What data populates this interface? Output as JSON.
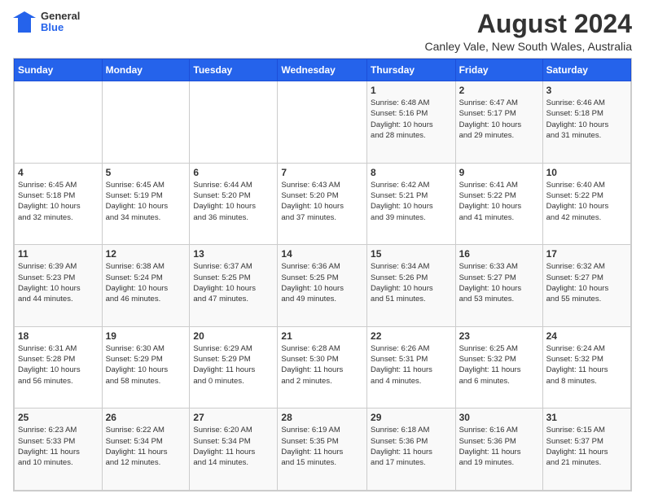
{
  "header": {
    "logo_general": "General",
    "logo_blue": "Blue",
    "main_title": "August 2024",
    "subtitle": "Canley Vale, New South Wales, Australia"
  },
  "calendar": {
    "headers": [
      "Sunday",
      "Monday",
      "Tuesday",
      "Wednesday",
      "Thursday",
      "Friday",
      "Saturday"
    ],
    "weeks": [
      [
        {
          "day": "",
          "info": ""
        },
        {
          "day": "",
          "info": ""
        },
        {
          "day": "",
          "info": ""
        },
        {
          "day": "",
          "info": ""
        },
        {
          "day": "1",
          "info": "Sunrise: 6:48 AM\nSunset: 5:16 PM\nDaylight: 10 hours\nand 28 minutes."
        },
        {
          "day": "2",
          "info": "Sunrise: 6:47 AM\nSunset: 5:17 PM\nDaylight: 10 hours\nand 29 minutes."
        },
        {
          "day": "3",
          "info": "Sunrise: 6:46 AM\nSunset: 5:18 PM\nDaylight: 10 hours\nand 31 minutes."
        }
      ],
      [
        {
          "day": "4",
          "info": "Sunrise: 6:45 AM\nSunset: 5:18 PM\nDaylight: 10 hours\nand 32 minutes."
        },
        {
          "day": "5",
          "info": "Sunrise: 6:45 AM\nSunset: 5:19 PM\nDaylight: 10 hours\nand 34 minutes."
        },
        {
          "day": "6",
          "info": "Sunrise: 6:44 AM\nSunset: 5:20 PM\nDaylight: 10 hours\nand 36 minutes."
        },
        {
          "day": "7",
          "info": "Sunrise: 6:43 AM\nSunset: 5:20 PM\nDaylight: 10 hours\nand 37 minutes."
        },
        {
          "day": "8",
          "info": "Sunrise: 6:42 AM\nSunset: 5:21 PM\nDaylight: 10 hours\nand 39 minutes."
        },
        {
          "day": "9",
          "info": "Sunrise: 6:41 AM\nSunset: 5:22 PM\nDaylight: 10 hours\nand 41 minutes."
        },
        {
          "day": "10",
          "info": "Sunrise: 6:40 AM\nSunset: 5:22 PM\nDaylight: 10 hours\nand 42 minutes."
        }
      ],
      [
        {
          "day": "11",
          "info": "Sunrise: 6:39 AM\nSunset: 5:23 PM\nDaylight: 10 hours\nand 44 minutes."
        },
        {
          "day": "12",
          "info": "Sunrise: 6:38 AM\nSunset: 5:24 PM\nDaylight: 10 hours\nand 46 minutes."
        },
        {
          "day": "13",
          "info": "Sunrise: 6:37 AM\nSunset: 5:25 PM\nDaylight: 10 hours\nand 47 minutes."
        },
        {
          "day": "14",
          "info": "Sunrise: 6:36 AM\nSunset: 5:25 PM\nDaylight: 10 hours\nand 49 minutes."
        },
        {
          "day": "15",
          "info": "Sunrise: 6:34 AM\nSunset: 5:26 PM\nDaylight: 10 hours\nand 51 minutes."
        },
        {
          "day": "16",
          "info": "Sunrise: 6:33 AM\nSunset: 5:27 PM\nDaylight: 10 hours\nand 53 minutes."
        },
        {
          "day": "17",
          "info": "Sunrise: 6:32 AM\nSunset: 5:27 PM\nDaylight: 10 hours\nand 55 minutes."
        }
      ],
      [
        {
          "day": "18",
          "info": "Sunrise: 6:31 AM\nSunset: 5:28 PM\nDaylight: 10 hours\nand 56 minutes."
        },
        {
          "day": "19",
          "info": "Sunrise: 6:30 AM\nSunset: 5:29 PM\nDaylight: 10 hours\nand 58 minutes."
        },
        {
          "day": "20",
          "info": "Sunrise: 6:29 AM\nSunset: 5:29 PM\nDaylight: 11 hours\nand 0 minutes."
        },
        {
          "day": "21",
          "info": "Sunrise: 6:28 AM\nSunset: 5:30 PM\nDaylight: 11 hours\nand 2 minutes."
        },
        {
          "day": "22",
          "info": "Sunrise: 6:26 AM\nSunset: 5:31 PM\nDaylight: 11 hours\nand 4 minutes."
        },
        {
          "day": "23",
          "info": "Sunrise: 6:25 AM\nSunset: 5:32 PM\nDaylight: 11 hours\nand 6 minutes."
        },
        {
          "day": "24",
          "info": "Sunrise: 6:24 AM\nSunset: 5:32 PM\nDaylight: 11 hours\nand 8 minutes."
        }
      ],
      [
        {
          "day": "25",
          "info": "Sunrise: 6:23 AM\nSunset: 5:33 PM\nDaylight: 11 hours\nand 10 minutes."
        },
        {
          "day": "26",
          "info": "Sunrise: 6:22 AM\nSunset: 5:34 PM\nDaylight: 11 hours\nand 12 minutes."
        },
        {
          "day": "27",
          "info": "Sunrise: 6:20 AM\nSunset: 5:34 PM\nDaylight: 11 hours\nand 14 minutes."
        },
        {
          "day": "28",
          "info": "Sunrise: 6:19 AM\nSunset: 5:35 PM\nDaylight: 11 hours\nand 15 minutes."
        },
        {
          "day": "29",
          "info": "Sunrise: 6:18 AM\nSunset: 5:36 PM\nDaylight: 11 hours\nand 17 minutes."
        },
        {
          "day": "30",
          "info": "Sunrise: 6:16 AM\nSunset: 5:36 PM\nDaylight: 11 hours\nand 19 minutes."
        },
        {
          "day": "31",
          "info": "Sunrise: 6:15 AM\nSunset: 5:37 PM\nDaylight: 11 hours\nand 21 minutes."
        }
      ]
    ]
  }
}
